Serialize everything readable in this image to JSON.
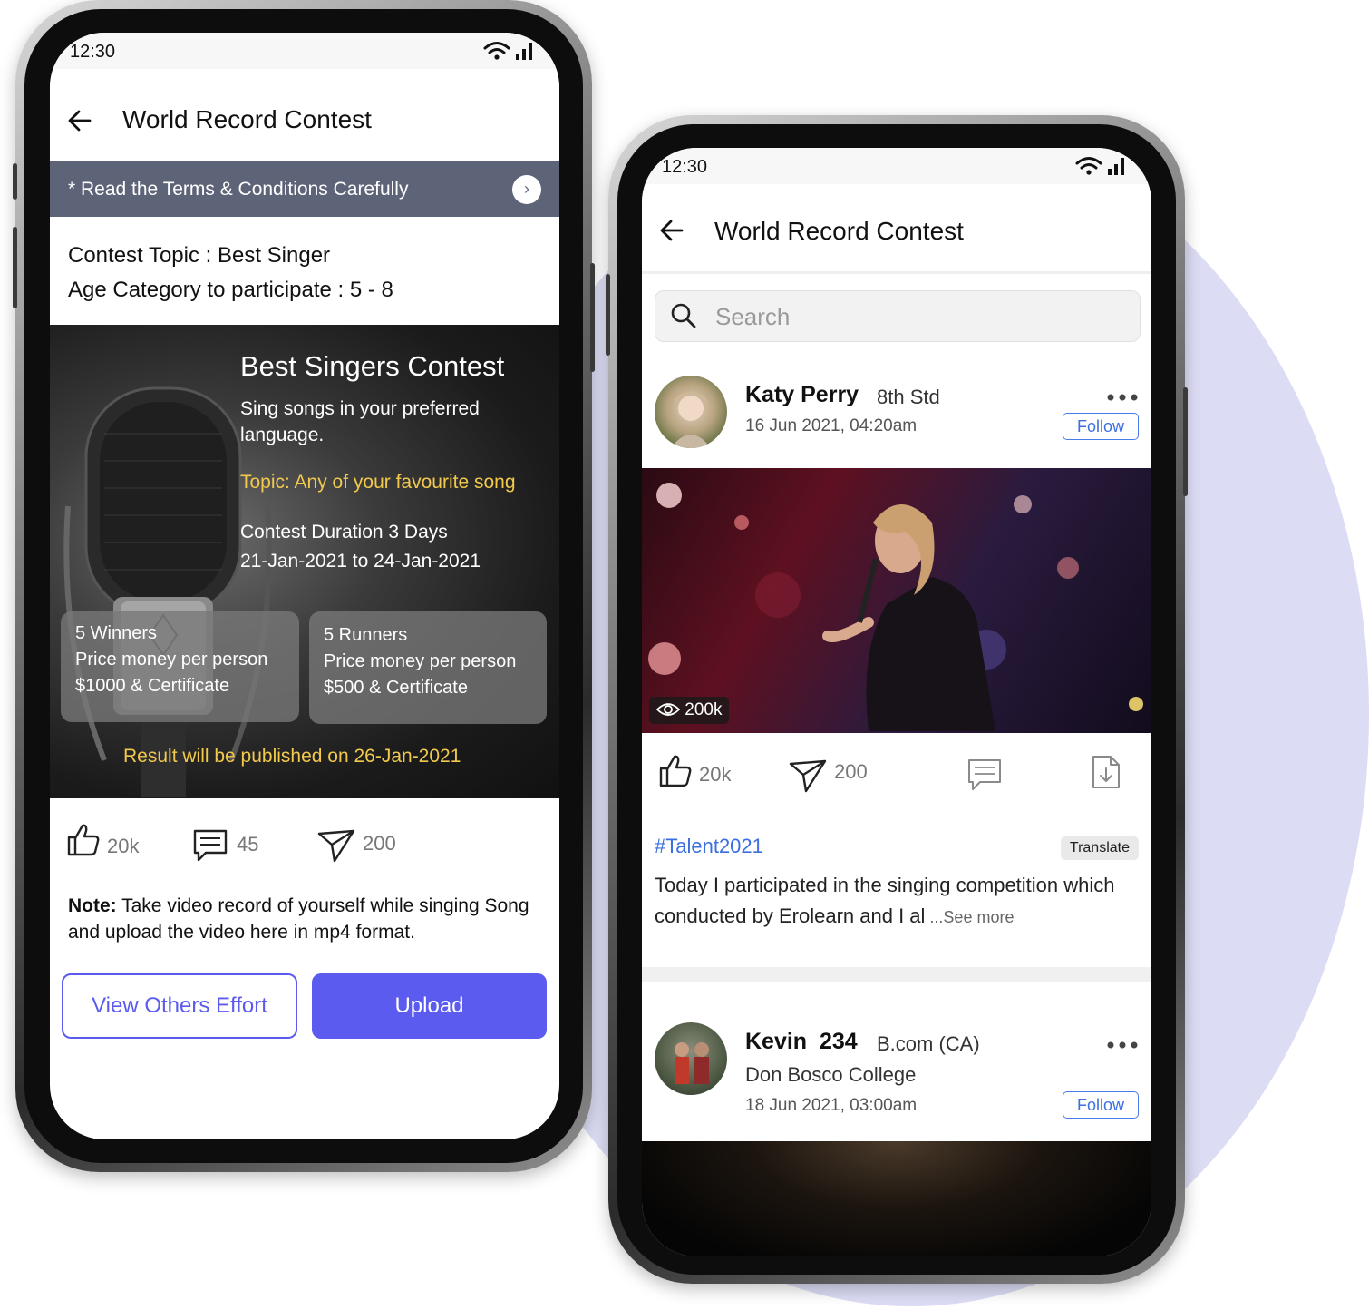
{
  "left_phone": {
    "status_time": "12:30",
    "title": "World Record Contest",
    "terms_text": "* Read the Terms & Conditions Carefully",
    "contest_topic": "Contest Topic : Best Singer",
    "age_category": "Age Category to participate :  5 - 8",
    "banner": {
      "heading": "Best Singers Contest",
      "subtitle": "Sing songs in your preferred language.",
      "topic": "Topic: Any of your favourite song",
      "duration": "Contest Duration 3 Days",
      "dates": "21-Jan-2021 to 24-Jan-2021",
      "winners": {
        "line1": "5 Winners",
        "line2": "Price money per person",
        "line3": "$1000 & Certificate"
      },
      "runners": {
        "line1": "5 Runners",
        "line2": "Price money per person",
        "line3": "$500 & Certificate"
      },
      "result": "Result will be published on 26-Jan-2021"
    },
    "stats": {
      "likes": "20k",
      "comments": "45",
      "shares": "200"
    },
    "note_label": "Note:",
    "note_text": " Take video record of yourself while singing Song and upload the video here in mp4 format.",
    "view_others_label": "View Others Effort",
    "upload_label": "Upload"
  },
  "right_phone": {
    "status_time": "12:30",
    "title": "World Record Contest",
    "search_placeholder": "Search",
    "post1": {
      "name": "Katy Perry",
      "grade": "8th Std",
      "date": "16 Jun 2021, 04:20am",
      "follow_label": "Follow",
      "views": "200k",
      "likes": "20k",
      "shares": "200",
      "hashtag": "#Talent2021",
      "translate_label": "Translate",
      "caption": "Today I participated in the singing competition which conducted by Erolearn and I al",
      "see_more": " ...See more"
    },
    "post2": {
      "name": "Kevin_234",
      "grade": "B.com (CA)",
      "college": "Don Bosco College",
      "date": "18 Jun 2021, 03:00am",
      "follow_label": "Follow"
    }
  },
  "colors": {
    "accent": "#5b5bf0",
    "terms_bar": "#5e6478",
    "highlight": "#f2c94c",
    "link": "#3b6fde",
    "backdrop": "#dcdcf5"
  }
}
